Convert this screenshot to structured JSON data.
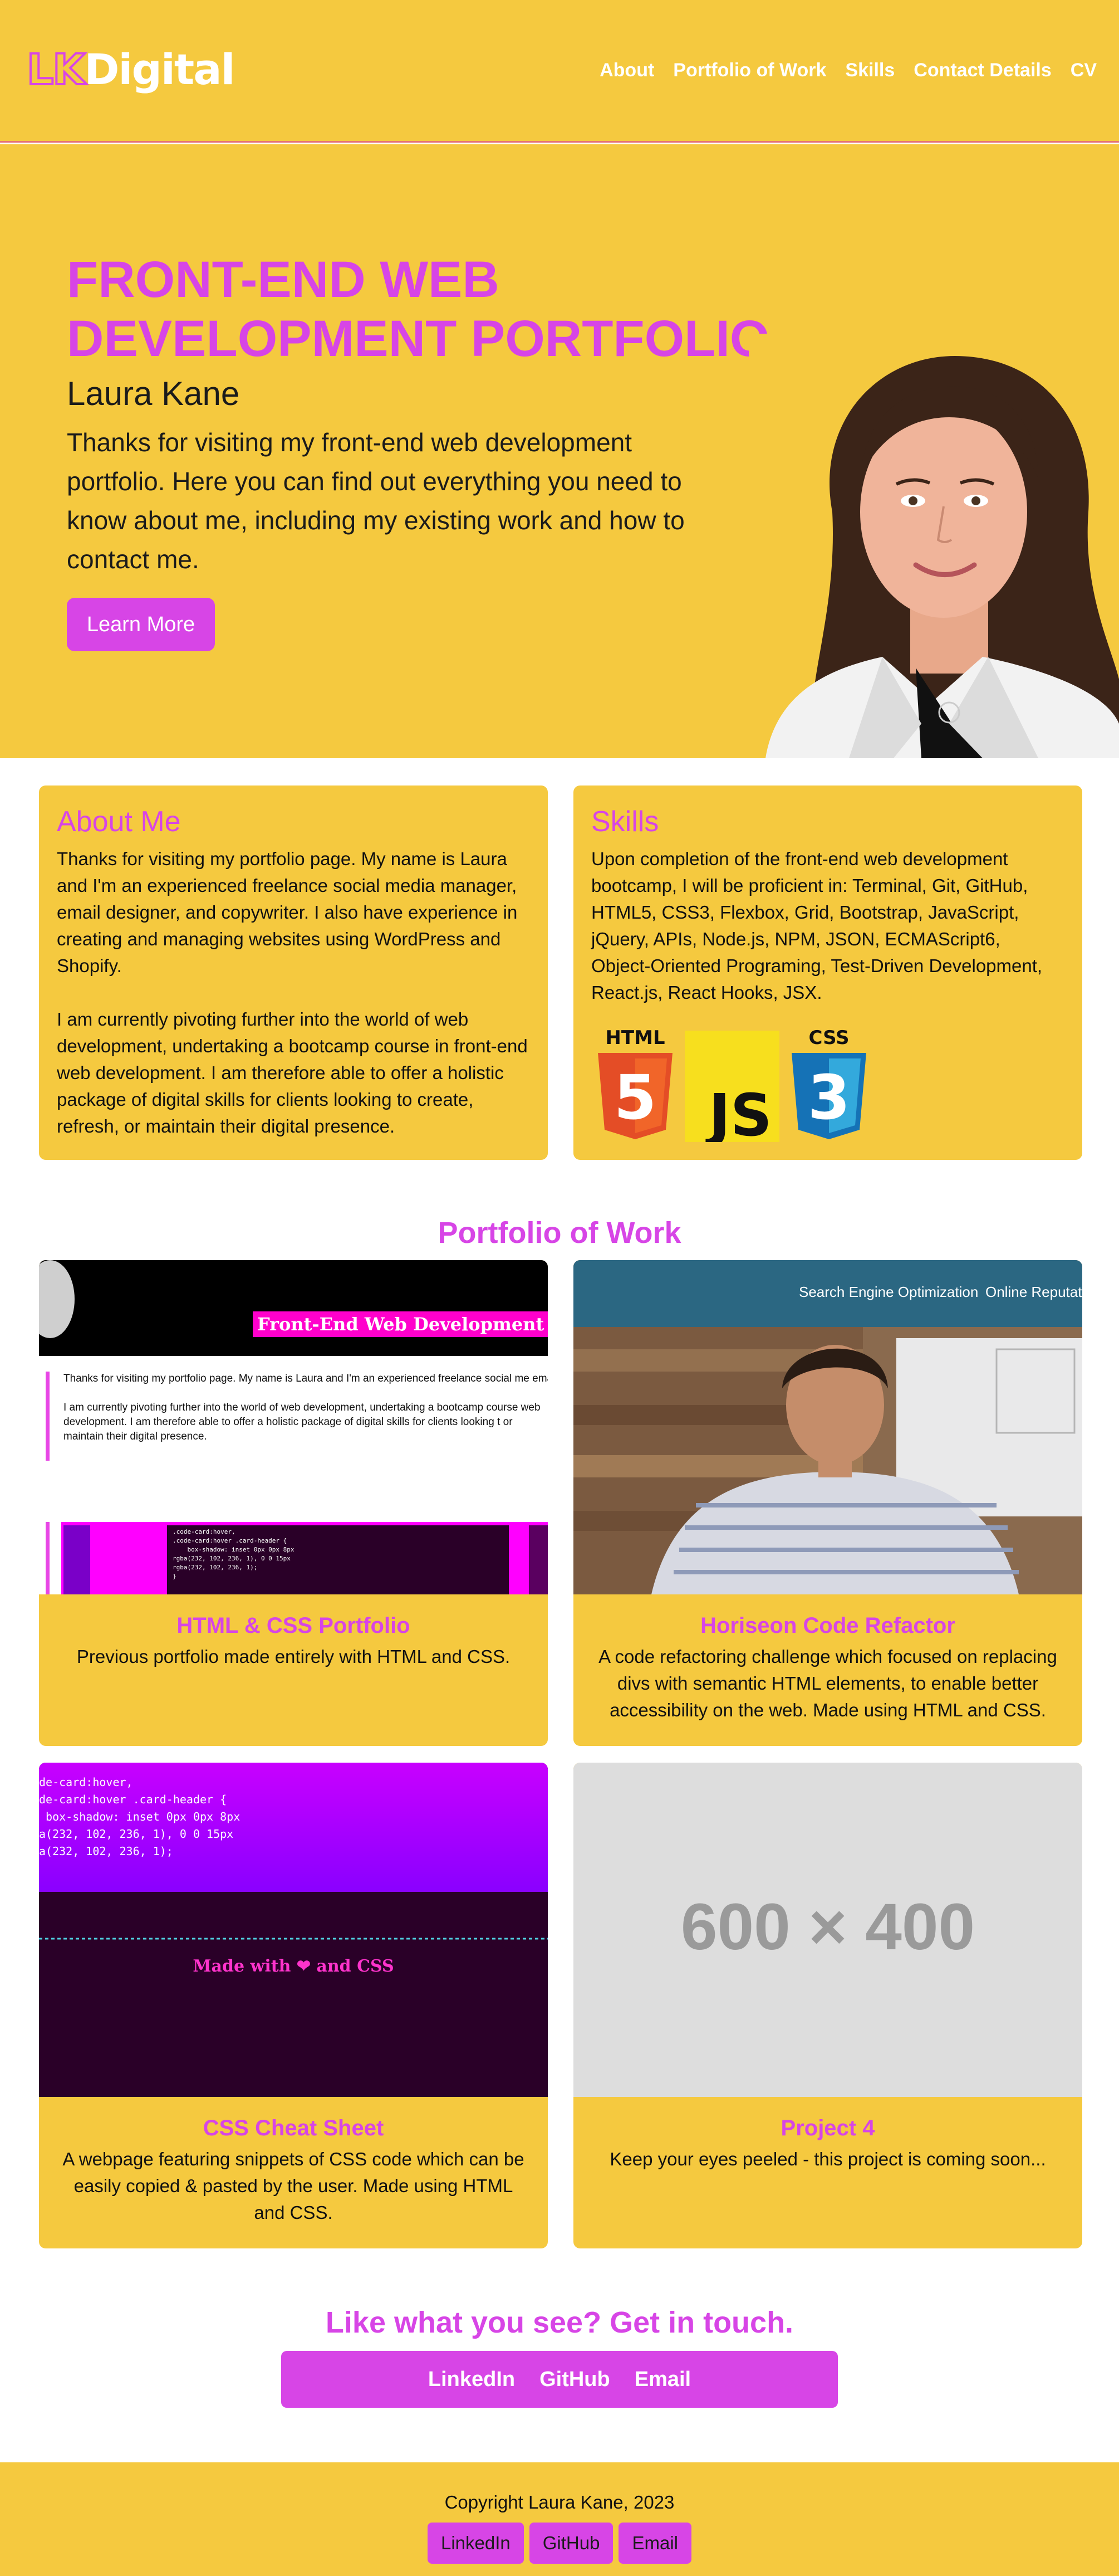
{
  "header": {
    "logo_lk": "LK",
    "logo_digital": "Digital",
    "nav": [
      "About",
      "Portfolio of Work",
      "Skills",
      "Contact Details",
      "CV"
    ]
  },
  "hero": {
    "title": "FRONT-END WEB DEVELOPMENT PORTFOLIO",
    "name": "Laura Kane",
    "text": "Thanks for visiting my front-end web development portfolio. Here you can find out everything you need to know about me, including my existing work and how to contact me.",
    "button": "Learn More"
  },
  "about": {
    "title": "About Me",
    "p1": "Thanks for visiting my portfolio page. My name is Laura and I'm an experienced freelance social media manager, email designer, and copywriter. I also have experience in creating and managing websites using WordPress and Shopify.",
    "p2": "I am currently pivoting further into the world of web development, undertaking a bootcamp course in front-end web development. I am therefore able to offer a holistic package of digital skills for clients looking to create, refresh, or maintain their digital presence."
  },
  "skills": {
    "title": "Skills",
    "text": "Upon completion of the front-end web development bootcamp, I will be proficient in: Terminal, Git, GitHub, HTML5, CSS3, Flexbox, Grid, Bootstrap, JavaScript, jQuery, APIs, Node.js, NPM, JSON, ECMAScript6, Object-Oriented Programing, Test-Driven Development, React.js, React Hooks, JSX.",
    "badges": {
      "html_label": "HTML",
      "html_num": "5",
      "js": "JS",
      "css_label": "CSS",
      "css_num": "3"
    }
  },
  "portfolio": {
    "title": "Portfolio of Work",
    "projects": [
      {
        "title": "HTML & CSS Portfolio",
        "text": "Previous portfolio made entirely with HTML and CSS.",
        "thumb": {
          "heading": "Front-End Web Development Po",
          "p1": "Thanks for visiting my portfolio page. My name is Laura and I'm an experienced freelance social me email designer, and copywriter. I also have experience in creating and managing websites using Wor Shopify.",
          "p2": "I am currently pivoting further into the world of web development, undertaking a bootcamp course web development. I am therefore able to offer a holistic package of digital skills for clients looking t or maintain their digital presence.",
          "code": ".code-card:hover,\n.code-card:hover .card-header {\n    box-shadow: inset 0px 0px 8px\nrgba(232, 102, 236, 1), 0 0 15px\nrgba(232, 102, 236, 1);\n}"
        }
      },
      {
        "title": "Horiseon Code Refactor",
        "text": "A code refactoring challenge which focused on replacing divs with semantic HTML elements, to enable better accessibility on the web. Made using HTML and CSS.",
        "thumb": {
          "nav1": "Search Engine Optimization",
          "nav2": "Online Reputatio"
        }
      },
      {
        "title": "CSS Cheat Sheet",
        "text": "A webpage featuring snippets of CSS code which can be easily copied & pasted by the user. Made using HTML and CSS.",
        "thumb": {
          "code": "de-card:hover,\nde-card:hover .card-header {\n box-shadow: inset 0px 0px 8px\na(232, 102, 236, 1), 0 0 15px\na(232, 102, 236, 1);",
          "made_with": "Made with ❤ and CSS"
        }
      },
      {
        "title": "Project 4",
        "text": "Keep your eyes peeled - this project is coming soon...",
        "thumb": {
          "placeholder": "600 × 400"
        }
      }
    ]
  },
  "contact": {
    "title": "Like what you see? Get in touch.",
    "links": [
      "LinkedIn",
      "GitHub",
      "Email"
    ]
  },
  "footer": {
    "copyright": "Copyright Laura Kane, 2023",
    "links": [
      "LinkedIn",
      "GitHub",
      "Email"
    ]
  },
  "colors": {
    "yellow": "#f5c93f",
    "magenta": "#d745e6",
    "text": "#111111"
  }
}
